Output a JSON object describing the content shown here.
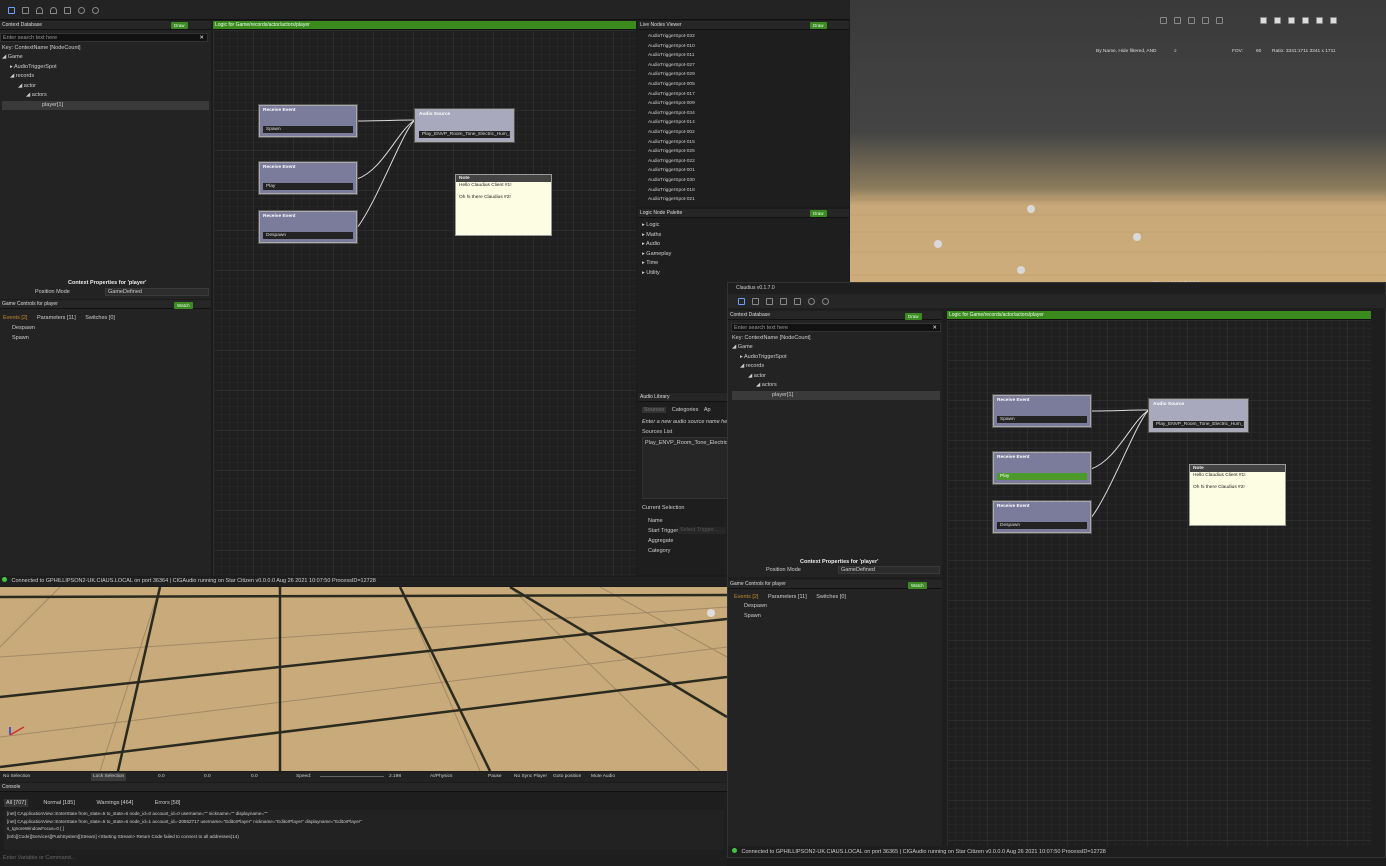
{
  "top_toolbar": {
    "icons": [
      "save-icon",
      "save-as-icon",
      "undo-icon",
      "redo-icon",
      "open-folder-icon",
      "record-icon",
      "settings-icon"
    ]
  },
  "left": {
    "context_db": {
      "title": "Context Database",
      "draw": "Draw",
      "search_placeholder": "Enter search text here",
      "key": "Key: ContextName [NodeCount]",
      "tree": [
        {
          "label": "Game",
          "depth": 0
        },
        {
          "label": "AudioTriggerSpot",
          "depth": 1
        },
        {
          "label": "records",
          "depth": 1
        },
        {
          "label": "actor",
          "depth": 2
        },
        {
          "label": "actors",
          "depth": 3
        },
        {
          "label": "player[1]",
          "depth": 4
        }
      ],
      "props_title": "Context Properties for 'player'",
      "position_mode_label": "Position Mode",
      "position_mode_value": "GameDefined"
    },
    "game_controls": {
      "title": "Game Controls for player",
      "watch": "Watch",
      "tabs": [
        "Events [2]",
        "Parameters [11]",
        "Switches [0]"
      ],
      "items": [
        "Despawn",
        "Spawn"
      ]
    },
    "logic": {
      "title": "Logic for Game/records/actor/actors/player",
      "nodes": [
        {
          "title": "Receive Event",
          "field": "Spawn"
        },
        {
          "title": "Receive Event",
          "field": "Play"
        },
        {
          "title": "Receive Event",
          "field": "Despawn"
        }
      ],
      "audio_source": {
        "title": "Audio Source",
        "field": "Play_ENVP_Room_Tone_Electric_Hum_Ma"
      },
      "note": {
        "title": "Note",
        "line1": "Hello Claudius Client #1!",
        "line2": "Oh hi there Claudius #2!"
      }
    },
    "live_nodes": {
      "title": "Live Nodes Viewer",
      "draw": "Draw",
      "items": [
        "AudioTriggerSpot-032",
        "AudioTriggerSpot-010",
        "AudioTriggerSpot-011",
        "AudioTriggerSpot-027",
        "AudioTriggerSpot-029",
        "AudioTriggerSpot-005",
        "AudioTriggerSpot-017",
        "AudioTriggerSpot-009",
        "AudioTriggerSpot-034",
        "AudioTriggerSpot-014",
        "AudioTriggerSpot-002",
        "AudioTriggerSpot-015",
        "AudioTriggerSpot-025",
        "AudioTriggerSpot-022",
        "AudioTriggerSpot-001",
        "AudioTriggerSpot-030",
        "AudioTriggerSpot-018",
        "AudioTriggerSpot-021"
      ]
    },
    "palette": {
      "title": "Logic Node Palette",
      "draw": "Draw",
      "items": [
        "Logic",
        "Maths",
        "Audio",
        "Gameplay",
        "Time",
        "Utility"
      ]
    },
    "audio_library": {
      "title": "Audio Library",
      "tabs": [
        "Sources",
        "Categories",
        "Ap"
      ],
      "placeholder": "Enter a new audio source name here",
      "sources_label": "Sources List",
      "source": "Play_ENVP_Room_Tone_Electric_Hum",
      "current_selection": "Current Selection",
      "fields": [
        "Name",
        "Start Trigger",
        "Aggregate",
        "Category"
      ],
      "trigger_placeholder": "Select Trigger..."
    },
    "status": "Connected to GPHILLIPSON2-UK.CIAUS.LOCAL on port 36364 | CIGAudio running on Star Citizen v0.0.0.0 Aug 26 2021 10:07:50 ProcessID=12728"
  },
  "viewport_top": {
    "search": "By Name, Hide filtered, AND",
    "fov_label": "FOV:",
    "fov": "60",
    "ratio": "Ratio: 3341:1711  3341 x 1711",
    "hot_reload": "Hot Reload",
    "pct": "99+"
  },
  "bottom": {
    "no_selection": "No Selection",
    "lock_selection": "Lock Selection",
    "x": "0.0",
    "y": "0.0",
    "z": "0.0",
    "speed_label": "Speed:",
    "speed": "2.198",
    "ai_physics": "AI/Physics",
    "pause": "Pause",
    "no_sync": "No Sync Player",
    "goto": "Goto position",
    "mute": "Mute Audio",
    "console": {
      "title": "Console",
      "tabs": [
        "All [707]",
        "Normal [185]",
        "Warnings [464]",
        "Errors [58]"
      ],
      "lines": [
        "[net] CApplicationView::EnterState from_state=5 to_state=6 node_id=0 account_id=0 username=\"\" nickname=\"\" displayname=\"\"",
        "[net] CApplicationView::EnterState from_state=5 to_state=6 node_id=1 account_id=-20552717 username=\"EditorPlayer\" nickname=\"EditorPlayer\" displayname=\"EditorPlayer\"",
        "s_IgnoreWindowFocus=0 [ ]",
        "[Info][Code][Services][PushSystem][Stream] <Starting Stream> Return Code failed to connect to all addresses(14)"
      ],
      "input_placeholder": "Enter Variable or Command..."
    }
  },
  "right": {
    "title": "Claudius v0.1.7.0",
    "context_db": {
      "title": "Context Database",
      "draw": "Draw",
      "search_placeholder": "Enter search text here",
      "key": "Key: ContextName [NodeCount]",
      "props_title": "Context Properties for 'player'",
      "position_mode_label": "Position Mode",
      "position_mode_value": "GameDefined"
    },
    "game_controls": {
      "title": "Game Controls for player",
      "watch": "Watch",
      "tabs": [
        "Events [2]",
        "Parameters [11]",
        "Switches [0]"
      ],
      "items": [
        "Despawn",
        "Spawn"
      ]
    },
    "logic": {
      "title": "Logic for Game/records/actor/actors/player",
      "audio_source_field": "Play_ENVP_Room_Tone_Electric_Hum_Ma"
    },
    "status": "Connected to GPHILLIPSON2-UK.CIAUS.LOCAL on port 36365 | CIGAudio running on Star Citizen v0.0.0.0 Aug 26 2021 10:07:50 ProcessID=12728"
  },
  "colors": {
    "accent_green": "#3c8a22",
    "node": "#7b7c9c",
    "note": "#fdfde3",
    "sand": "#c8a878"
  }
}
